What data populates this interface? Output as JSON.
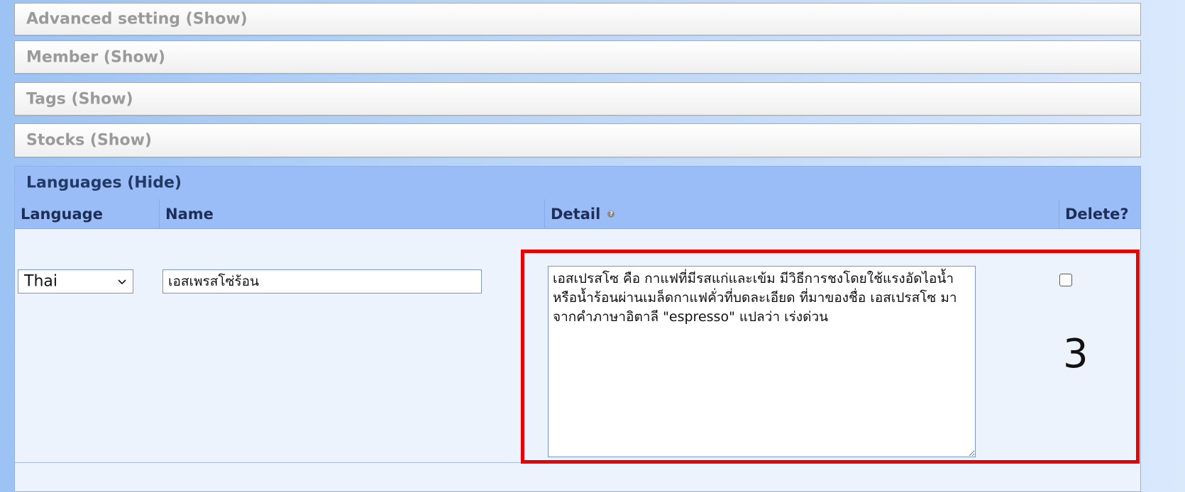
{
  "sections": {
    "advanced": "Advanced setting (Show)",
    "member": "Member (Show)",
    "tags": "Tags (Show)",
    "stocks": "Stocks (Show)"
  },
  "languages": {
    "title": "Languages (Hide)",
    "columns": {
      "language": "Language",
      "name": "Name",
      "detail": "Detail",
      "delete": "Delete?"
    },
    "row": {
      "language_value": "Thai",
      "name_value": "เอสเพรสโซ่ร้อน",
      "detail_value": "เอสเปรสโซ คือ กาแฟที่มีรสแก่และเข้ม มีวิธีการชงโดยใช้แรงอัดไอน้ำหรือน้ำร้อนผ่านเมล็ดกาแฟคั่วที่บดละเอียด ที่มาของชื่อ เอสเปรสโซ มาจากคำภาษาอิตาลี \"espresso\" แปลว่า เร่งด่วน",
      "delete_checked": false
    }
  },
  "annotation": {
    "step_number": "3",
    "color": "#e60000"
  },
  "colors": {
    "header_blue": "#9bbdf7",
    "panel_bg": "#edf3fd",
    "collapsed_title": "#9a9a9a"
  }
}
